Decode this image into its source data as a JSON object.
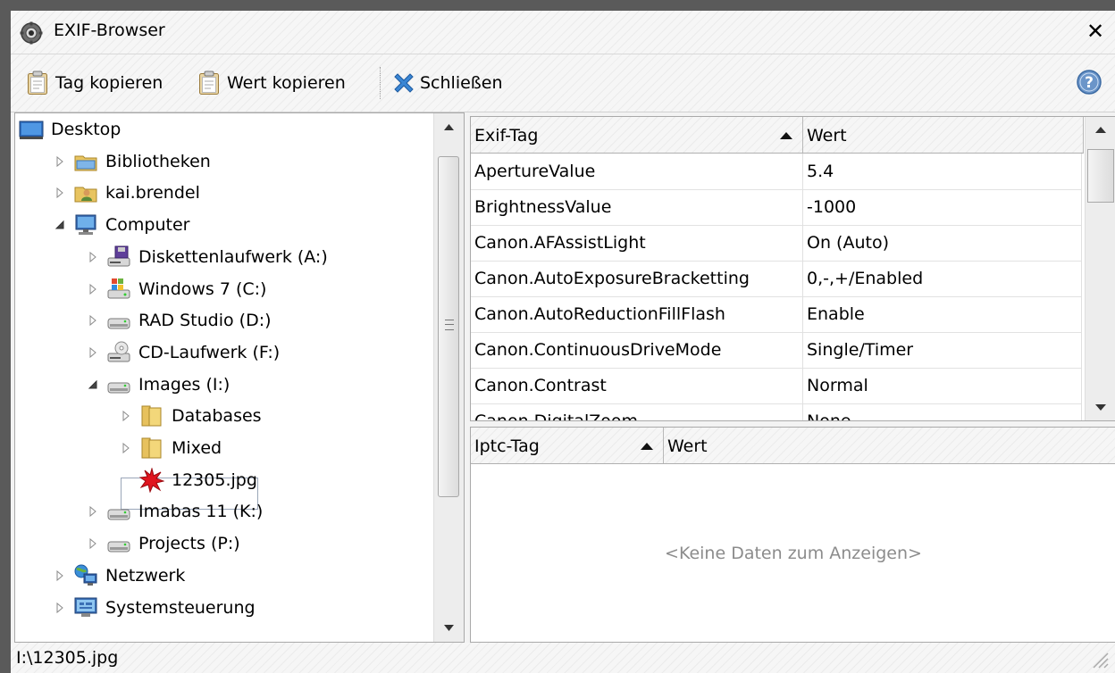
{
  "window": {
    "title": "EXIF-Browser"
  },
  "toolbar": {
    "copy_tag_label": "Tag kopieren",
    "copy_value_label": "Wert kopieren",
    "close_label": "Schließen",
    "help_icon": "help-icon"
  },
  "tree": {
    "items": [
      {
        "label": "Desktop",
        "icon": "desktop-icon",
        "expander": "none"
      },
      {
        "label": "Bibliotheken",
        "icon": "libraries-icon",
        "expander": "collapsed"
      },
      {
        "label": "kai.brendel",
        "icon": "user-folder-icon",
        "expander": "collapsed"
      },
      {
        "label": "Computer",
        "icon": "computer-icon",
        "expander": "expanded"
      },
      {
        "label": "Diskettenlaufwerk (A:)",
        "icon": "floppy-drive-icon",
        "expander": "collapsed"
      },
      {
        "label": "Windows 7 (C:)",
        "icon": "system-drive-icon",
        "expander": "collapsed"
      },
      {
        "label": "RAD Studio (D:)",
        "icon": "hard-drive-icon",
        "expander": "collapsed"
      },
      {
        "label": "CD-Laufwerk (F:)",
        "icon": "cd-drive-icon",
        "expander": "collapsed"
      },
      {
        "label": "Images (I:)",
        "icon": "hard-drive-icon",
        "expander": "expanded"
      },
      {
        "label": "Databases",
        "icon": "folder-icon",
        "expander": "collapsed"
      },
      {
        "label": "Mixed",
        "icon": "folder-icon",
        "expander": "collapsed"
      },
      {
        "label": "12305.jpg",
        "icon": "image-file-icon",
        "expander": "none",
        "selected": true
      },
      {
        "label": "Imabas 11 (K:)",
        "icon": "hard-drive-icon",
        "expander": "collapsed"
      },
      {
        "label": "Projects (P:)",
        "icon": "hard-drive-icon",
        "expander": "collapsed"
      },
      {
        "label": "Netzwerk",
        "icon": "network-icon",
        "expander": "collapsed"
      },
      {
        "label": "Systemsteuerung",
        "icon": "control-panel-icon",
        "expander": "collapsed"
      }
    ]
  },
  "exif": {
    "columns": [
      "Exif-Tag",
      "Wert"
    ],
    "sort_column": "Exif-Tag",
    "rows": [
      {
        "tag": "ApertureValue",
        "value": "5.4"
      },
      {
        "tag": "BrightnessValue",
        "value": "-1000"
      },
      {
        "tag": "Canon.AFAssistLight",
        "value": "On (Auto)"
      },
      {
        "tag": "Canon.AutoExposureBracketting",
        "value": "0,-,+/Enabled"
      },
      {
        "tag": "Canon.AutoReductionFillFlash",
        "value": "Enable"
      },
      {
        "tag": "Canon.ContinuousDriveMode",
        "value": "Single/Timer"
      },
      {
        "tag": "Canon.Contrast",
        "value": "Normal"
      },
      {
        "tag": "Canon.DigitalZoom",
        "value": "None"
      }
    ]
  },
  "iptc": {
    "columns": [
      "Iptc-Tag",
      "Wert"
    ],
    "sort_column": "Iptc-Tag",
    "empty_text": "<Keine Daten zum Anzeigen>"
  },
  "status": {
    "path": "I:\\12305.jpg"
  },
  "colors": {
    "selection_border": "#9aa6b8",
    "empty_text": "#8c8c8c",
    "window_frame": "#5a5a5a"
  }
}
